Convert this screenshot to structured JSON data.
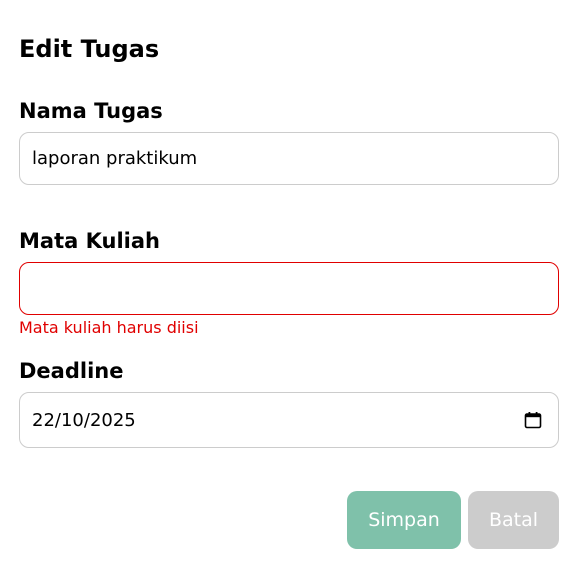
{
  "form": {
    "title": "Edit Tugas",
    "task_name": {
      "label": "Nama Tugas",
      "value": "laporan praktikum"
    },
    "course": {
      "label": "Mata Kuliah",
      "value": "",
      "error": "Mata kuliah harus diisi"
    },
    "deadline": {
      "label": "Deadline",
      "value": "22/10/2025",
      "icon": "calendar-icon"
    },
    "buttons": {
      "save_label": "Simpan",
      "cancel_label": "Batal"
    }
  },
  "colors": {
    "save_button": "#7fc1aa",
    "cancel_button": "#cccccc",
    "error": "#e00000",
    "border": "#cccccc"
  }
}
